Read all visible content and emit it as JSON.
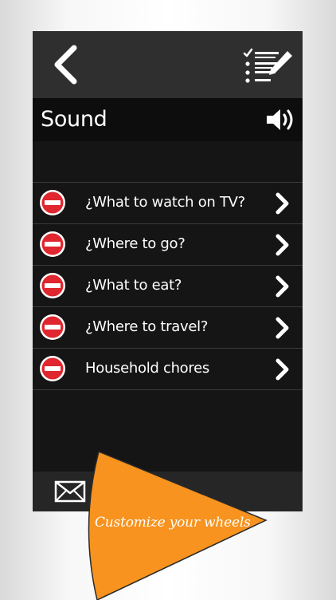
{
  "header": {
    "back_icon": "chevron-left-icon",
    "edit_icon": "checklist-edit-icon"
  },
  "sound": {
    "label": "Sound",
    "icon": "speaker-icon"
  },
  "list": {
    "items": [
      {
        "label": "¿What to watch on TV?"
      },
      {
        "label": "¿Where to go?"
      },
      {
        "label": "¿What to eat?"
      },
      {
        "label": "¿Where to travel?"
      },
      {
        "label": "Household chores"
      }
    ],
    "delete_icon": "no-entry-icon",
    "chevron_icon": "chevron-right-icon",
    "delete_color": "#e0262e"
  },
  "bottom": {
    "mail_icon": "envelope-icon"
  },
  "promo": {
    "text": "Customize your wheels",
    "color": "#f7931e"
  },
  "colors": {
    "app_background": "#151515",
    "header_background": "#2f2f2f"
  }
}
